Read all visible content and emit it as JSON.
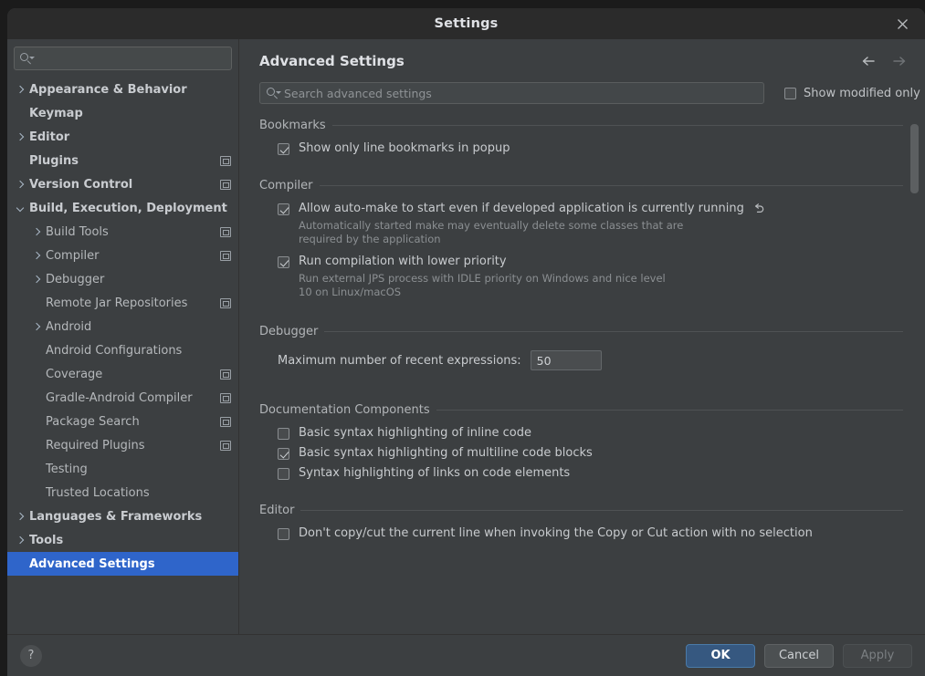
{
  "window": {
    "title": "Settings",
    "close_icon": "close-icon"
  },
  "sidebar": {
    "search_placeholder": "",
    "search_value": "",
    "items": [
      {
        "label": "Appearance & Behavior",
        "indent": 0,
        "chevron": "right",
        "bold": true,
        "mod": false,
        "selected": false
      },
      {
        "label": "Keymap",
        "indent": 0,
        "chevron": "none",
        "bold": true,
        "mod": false,
        "selected": false
      },
      {
        "label": "Editor",
        "indent": 0,
        "chevron": "right",
        "bold": true,
        "mod": false,
        "selected": false
      },
      {
        "label": "Plugins",
        "indent": 0,
        "chevron": "none",
        "bold": true,
        "mod": true,
        "selected": false
      },
      {
        "label": "Version Control",
        "indent": 0,
        "chevron": "right",
        "bold": true,
        "mod": true,
        "selected": false
      },
      {
        "label": "Build, Execution, Deployment",
        "indent": 0,
        "chevron": "down",
        "bold": true,
        "mod": false,
        "selected": false
      },
      {
        "label": "Build Tools",
        "indent": 1,
        "chevron": "right",
        "bold": false,
        "mod": true,
        "selected": false
      },
      {
        "label": "Compiler",
        "indent": 1,
        "chevron": "right",
        "bold": false,
        "mod": true,
        "selected": false
      },
      {
        "label": "Debugger",
        "indent": 1,
        "chevron": "right",
        "bold": false,
        "mod": false,
        "selected": false
      },
      {
        "label": "Remote Jar Repositories",
        "indent": 1,
        "chevron": "none",
        "bold": false,
        "mod": true,
        "selected": false
      },
      {
        "label": "Android",
        "indent": 1,
        "chevron": "right",
        "bold": false,
        "mod": false,
        "selected": false
      },
      {
        "label": "Android Configurations",
        "indent": 1,
        "chevron": "none",
        "bold": false,
        "mod": false,
        "selected": false
      },
      {
        "label": "Coverage",
        "indent": 1,
        "chevron": "none",
        "bold": false,
        "mod": true,
        "selected": false
      },
      {
        "label": "Gradle-Android Compiler",
        "indent": 1,
        "chevron": "none",
        "bold": false,
        "mod": true,
        "selected": false
      },
      {
        "label": "Package Search",
        "indent": 1,
        "chevron": "none",
        "bold": false,
        "mod": true,
        "selected": false
      },
      {
        "label": "Required Plugins",
        "indent": 1,
        "chevron": "none",
        "bold": false,
        "mod": true,
        "selected": false
      },
      {
        "label": "Testing",
        "indent": 1,
        "chevron": "none",
        "bold": false,
        "mod": false,
        "selected": false
      },
      {
        "label": "Trusted Locations",
        "indent": 1,
        "chevron": "none",
        "bold": false,
        "mod": false,
        "selected": false
      },
      {
        "label": "Languages & Frameworks",
        "indent": 0,
        "chevron": "right",
        "bold": true,
        "mod": false,
        "selected": false
      },
      {
        "label": "Tools",
        "indent": 0,
        "chevron": "right",
        "bold": true,
        "mod": false,
        "selected": false
      },
      {
        "label": "Advanced Settings",
        "indent": 0,
        "chevron": "none",
        "bold": true,
        "mod": false,
        "selected": true
      }
    ]
  },
  "content": {
    "page_title": "Advanced Settings",
    "nav": {
      "back_icon": "arrow-left-icon",
      "forward_icon": "arrow-right-icon"
    },
    "search": {
      "placeholder": "Search advanced settings",
      "value": ""
    },
    "show_modified_only": {
      "label": "Show modified only",
      "checked": false
    },
    "groups": [
      {
        "title": "Bookmarks",
        "options": [
          {
            "type": "checkbox",
            "label": "Show only line bookmarks in popup",
            "checked": true,
            "desc": "",
            "revert": false
          }
        ]
      },
      {
        "title": "Compiler",
        "options": [
          {
            "type": "checkbox",
            "label": "Allow auto-make to start even if developed application is currently running",
            "checked": true,
            "desc": "Automatically started make may eventually delete some classes that are\nrequired by the application",
            "revert": true
          },
          {
            "type": "checkbox",
            "label": "Run compilation with lower priority",
            "checked": true,
            "desc": "Run external JPS process with IDLE priority on Windows and nice level\n10 on Linux/macOS",
            "revert": false
          }
        ]
      },
      {
        "title": "Debugger",
        "options": [
          {
            "type": "field",
            "label": "Maximum number of recent expressions:",
            "value": "50"
          }
        ]
      },
      {
        "title": "Documentation Components",
        "options": [
          {
            "type": "checkbox",
            "label": "Basic syntax highlighting of inline code",
            "checked": false,
            "desc": "",
            "revert": false
          },
          {
            "type": "checkbox",
            "label": "Basic syntax highlighting of multiline code blocks",
            "checked": true,
            "desc": "",
            "revert": false
          },
          {
            "type": "checkbox",
            "label": "Syntax highlighting of links on code elements",
            "checked": false,
            "desc": "",
            "revert": false
          }
        ]
      },
      {
        "title": "Editor",
        "options": [
          {
            "type": "checkbox",
            "label": "Don't copy/cut the current line when invoking the Copy or Cut action with no selection",
            "checked": false,
            "desc": "",
            "revert": false
          }
        ]
      }
    ]
  },
  "footer": {
    "help_label": "?",
    "ok_label": "OK",
    "cancel_label": "Cancel",
    "apply_label": "Apply"
  },
  "colors": {
    "accent": "#2f65ca",
    "primary_button": "#365880",
    "dialog_bg": "#3c3f41",
    "titlebar_bg": "#2b2b2b"
  }
}
